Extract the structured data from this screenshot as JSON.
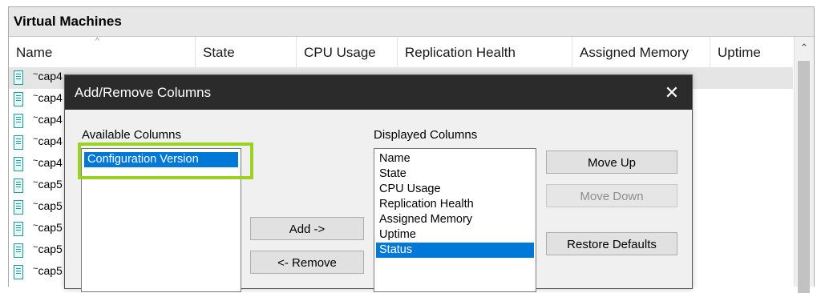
{
  "panel": {
    "title": "Virtual Machines"
  },
  "columns": [
    "Name",
    "State",
    "CPU Usage",
    "Replication Health",
    "Assigned Memory",
    "Uptime"
  ],
  "vm_rows": [
    {
      "name": "cap4"
    },
    {
      "name": "cap4"
    },
    {
      "name": "cap4"
    },
    {
      "name": "cap4"
    },
    {
      "name": "cap4"
    },
    {
      "name": "cap5"
    },
    {
      "name": "cap5"
    },
    {
      "name": "cap5"
    },
    {
      "name": "cap5"
    },
    {
      "name": "cap5"
    }
  ],
  "dialog": {
    "title": "Add/Remove Columns",
    "close_label": "✕",
    "available_label": "Available Columns",
    "available_columns": [
      "Configuration Version"
    ],
    "displayed_label": "Displayed Columns",
    "displayed_columns": [
      "Name",
      "State",
      "CPU Usage",
      "Replication Health",
      "Assigned Memory",
      "Uptime",
      "Status"
    ],
    "add_label": "Add ->",
    "remove_label": "<- Remove",
    "move_up_label": "Move Up",
    "move_down_label": "Move Down",
    "restore_label": "Restore Defaults"
  },
  "colors": {
    "selection": "#0078d7",
    "highlight": "#9bd21f",
    "titlebar": "#2b2b2b"
  }
}
